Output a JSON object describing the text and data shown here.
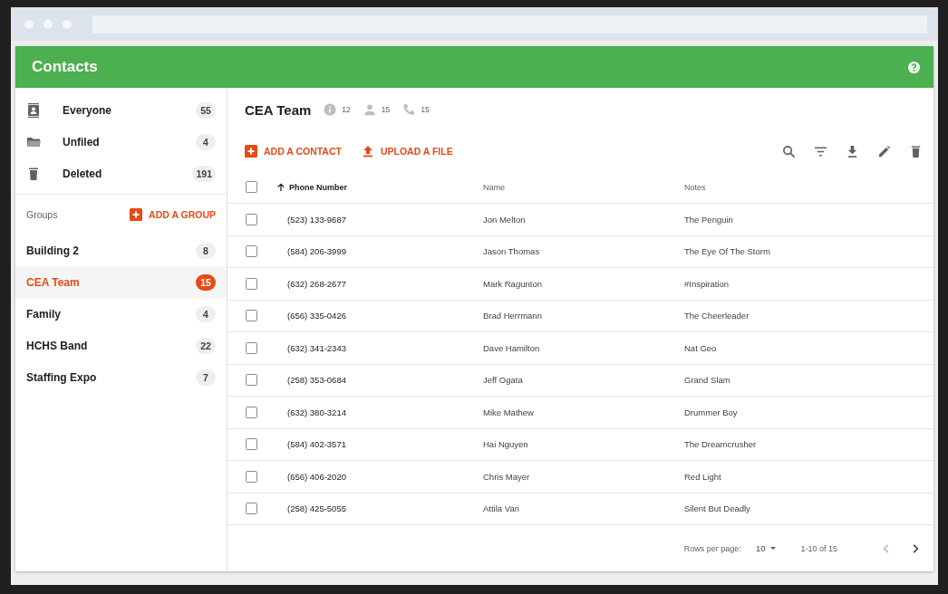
{
  "app": {
    "title": "Contacts"
  },
  "sidebar": {
    "system_items": [
      {
        "label": "Everyone",
        "count": "55"
      },
      {
        "label": "Unfiled",
        "count": "4"
      },
      {
        "label": "Deleted",
        "count": "191"
      }
    ],
    "groups_label": "Groups",
    "add_group": "ADD A GROUP",
    "groups": [
      {
        "label": "Building 2",
        "count": "8",
        "selected": false
      },
      {
        "label": "CEA Team",
        "count": "15",
        "selected": true
      },
      {
        "label": "Family",
        "count": "4",
        "selected": false
      },
      {
        "label": "HCHS Band",
        "count": "22",
        "selected": false
      },
      {
        "label": "Staffing Expo",
        "count": "7",
        "selected": false
      }
    ]
  },
  "group": {
    "title": "CEA Team",
    "info_count": "12",
    "people_count": "15",
    "phone_count": "15"
  },
  "actions": {
    "add_contact": "ADD A CONTACT",
    "upload_file": "UPLOAD A FILE"
  },
  "table": {
    "select_all_checked": false,
    "columns": [
      "Phone Number",
      "Name",
      "Notes"
    ],
    "rows": [
      {
        "phone": "(523) 133-9687",
        "name": "Jon Melton",
        "notes": "The Penguin",
        "checked": false
      },
      {
        "phone": "(584) 206-3999",
        "name": "Jason Thomas",
        "notes": "The Eye Of The Storm",
        "checked": false
      },
      {
        "phone": "(632) 268-2677",
        "name": "Mark Ragunton",
        "notes": "#Inspiration",
        "checked": false
      },
      {
        "phone": "(656) 335-0426",
        "name": "Brad Herrmann",
        "notes": "The Cheerleader",
        "checked": false
      },
      {
        "phone": "(632) 341-2343",
        "name": "Dave Hamilton",
        "notes": "Nat Geo",
        "checked": false
      },
      {
        "phone": "(258) 353-0684",
        "name": "Jeff Ogata",
        "notes": "Grand Slam",
        "checked": false
      },
      {
        "phone": "(632) 380-3214",
        "name": "Mike Mathew",
        "notes": "Drummer Boy",
        "checked": false
      },
      {
        "phone": "(584) 402-3571",
        "name": "Hai Nguyen",
        "notes": "The Dreamcrusher",
        "checked": false
      },
      {
        "phone": "(656) 406-2020",
        "name": "Chris Mayer",
        "notes": "Red Light",
        "checked": false
      },
      {
        "phone": "(258) 425-5055",
        "name": "Attila Vari",
        "notes": "Silent But Deadly",
        "checked": false
      }
    ]
  },
  "pagination": {
    "rows_per_page_label": "Rows per page:",
    "rows_per_page": "10",
    "range": "1-10 of 15",
    "prev_disabled": true,
    "next_disabled": false
  }
}
